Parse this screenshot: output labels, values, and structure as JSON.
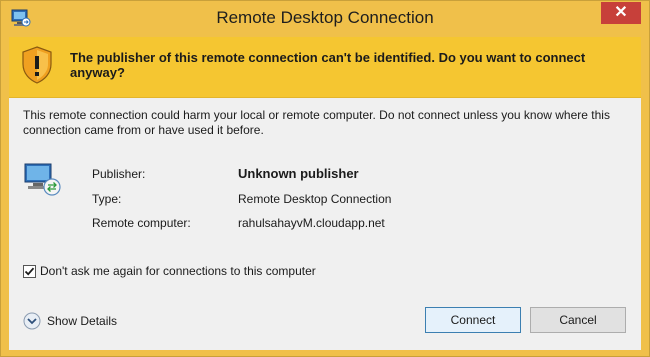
{
  "window": {
    "title": "Remote Desktop Connection",
    "close_label": "✕"
  },
  "banner": {
    "message": "The publisher of this remote connection can't be identified. Do you want to connect anyway?"
  },
  "content": {
    "warning": "This remote connection could harm your local or remote computer. Do not connect unless you know where this connection came from or have used it before.",
    "info": {
      "publisher_label": "Publisher:",
      "publisher_value": "Unknown publisher",
      "type_label": "Type:",
      "type_value": "Remote Desktop Connection",
      "remote_label": "Remote computer:",
      "remote_value": "rahulsahayvM.cloudapp.net"
    },
    "checkbox": {
      "label": "Don't ask me again for connections to this computer",
      "checked": true
    },
    "details_label": "Show Details",
    "connect_label": "Connect",
    "cancel_label": "Cancel"
  },
  "colors": {
    "titlebar": "#f0c04a",
    "banner": "#f5c631",
    "close": "#c7403a",
    "body": "#f0f0f0"
  }
}
